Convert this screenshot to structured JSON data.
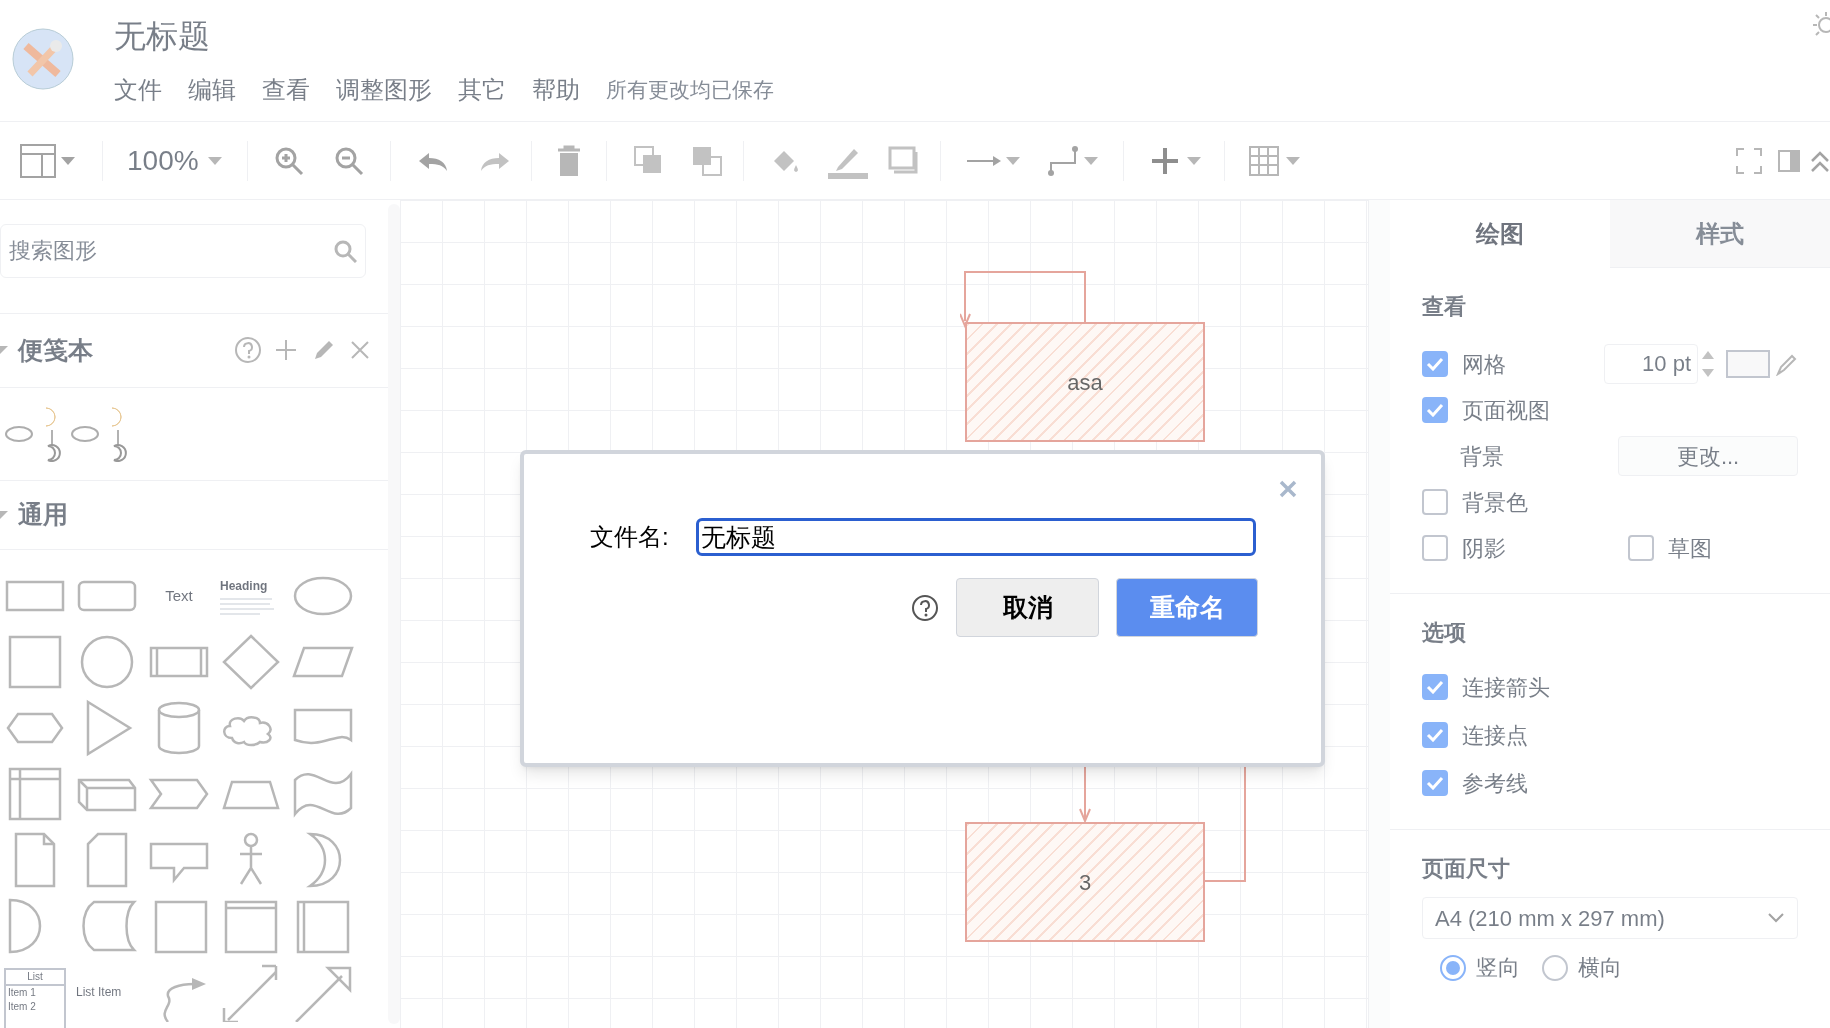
{
  "app": {
    "title": "无标题",
    "menu": [
      "文件",
      "编辑",
      "查看",
      "调整图形",
      "其它",
      "帮助"
    ],
    "save_status": "所有更改均已保存"
  },
  "toolbar": {
    "zoom": "100%"
  },
  "sidebar": {
    "search": {
      "placeholder": "搜索图形"
    },
    "scratchpad": {
      "title": "便笺本"
    },
    "general": {
      "title": "通用",
      "text_shape": "Text",
      "heading_shape": "Heading",
      "list_title": "List",
      "list_items": [
        "Item 1",
        "Item 2"
      ],
      "list_item_shape": "List Item"
    }
  },
  "canvas": {
    "nodes": [
      {
        "label": "asa"
      },
      {
        "label": "3"
      }
    ]
  },
  "format_panel": {
    "tabs": [
      {
        "label": "绘图",
        "selected": true
      },
      {
        "label": "样式",
        "selected": false
      }
    ],
    "view": {
      "title": "查看",
      "grid": {
        "label": "网格",
        "checked": true,
        "size": "10 pt"
      },
      "page_view": {
        "label": "页面视图",
        "checked": true
      },
      "background": {
        "label": "背景",
        "button": "更改..."
      },
      "background_color": {
        "label": "背景色",
        "checked": false
      },
      "shadow": {
        "label": "阴影",
        "checked": false
      },
      "sketch": {
        "label": "草图",
        "checked": false
      }
    },
    "options": {
      "title": "选项",
      "items": [
        {
          "label": "连接箭头",
          "checked": true
        },
        {
          "label": "连接点",
          "checked": true
        },
        {
          "label": "参考线",
          "checked": true
        }
      ]
    },
    "page_size": {
      "title": "页面尺寸",
      "value": "A4 (210 mm x 297 mm)",
      "orientation": [
        {
          "label": "竖向",
          "selected": true
        },
        {
          "label": "横向",
          "selected": false
        }
      ]
    }
  },
  "dialog": {
    "label": "文件名:",
    "value": "无标题",
    "cancel": "取消",
    "rename": "重命名"
  }
}
